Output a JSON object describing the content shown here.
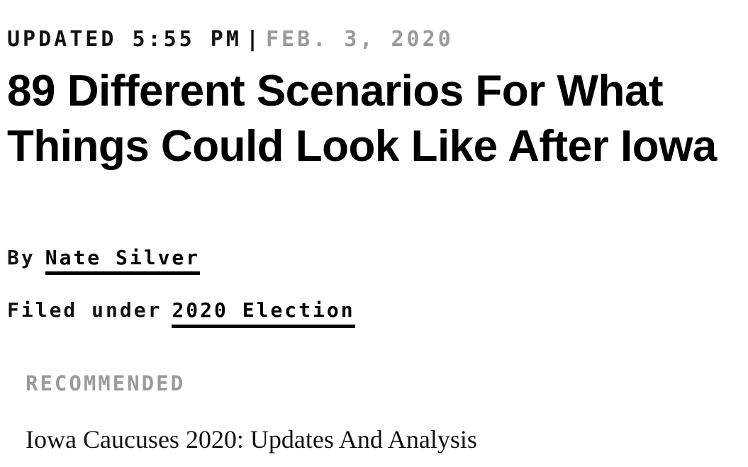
{
  "article": {
    "dateline": {
      "updated": "UPDATED 5:55 PM",
      "separator": "|",
      "date": "FEB. 3, 2020"
    },
    "headline": "89 Different Scenarios For What Things Could Look Like After Iowa",
    "byline": {
      "prefix": "By",
      "author": "Nate Silver"
    },
    "filed": {
      "prefix": "Filed under",
      "topic": "2020 Election"
    }
  },
  "recommended": {
    "label": "RECOMMENDED",
    "items": [
      {
        "title": "Iowa Caucuses 2020: Updates And Analysis"
      }
    ]
  },
  "colors": {
    "text": "#000000",
    "muted": "#9a9a9a",
    "background": "#ffffff"
  }
}
